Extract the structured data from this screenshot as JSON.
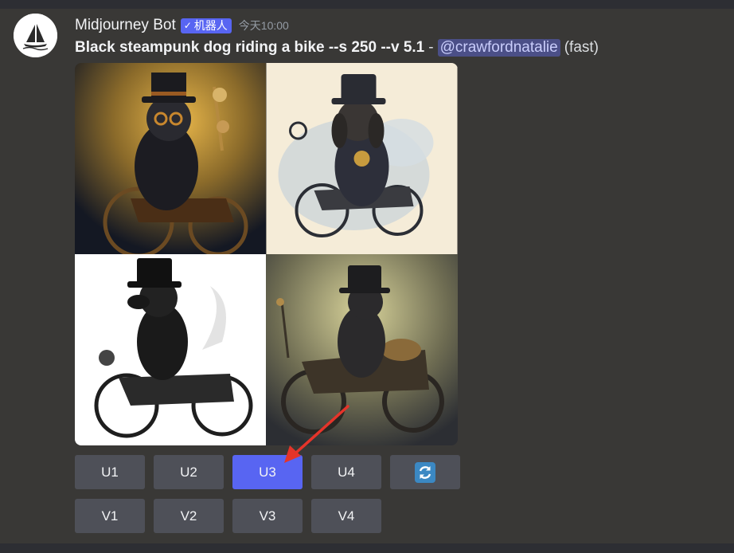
{
  "author": {
    "name": "Midjourney Bot",
    "badge": "机器人",
    "badge_check": "✓",
    "timestamp": "今天10:00",
    "avatar_icon": "sailboat-icon"
  },
  "message": {
    "prompt": "Black steampunk dog riding a bike --s 250 --v 5.1",
    "separator": "-",
    "mention": "@crawfordnatalie",
    "speed": "(fast)"
  },
  "images": [
    {
      "name": "dog-image-1",
      "background": "#1c1f2b"
    },
    {
      "name": "dog-image-2",
      "background": "#f4ebd8"
    },
    {
      "name": "dog-image-3",
      "background": "#ffffff"
    },
    {
      "name": "dog-image-4",
      "background": "#6f6e55"
    }
  ],
  "buttons": {
    "upscale": [
      "U1",
      "U2",
      "U3",
      "U4"
    ],
    "variation": [
      "V1",
      "V2",
      "V3",
      "V4"
    ],
    "reroll_icon": "reroll-icon",
    "selected": "U3"
  },
  "colors": {
    "background": "#393836",
    "button": "#4e5058",
    "button_selected": "#5865f2",
    "annotation_arrow": "#e5342a"
  }
}
